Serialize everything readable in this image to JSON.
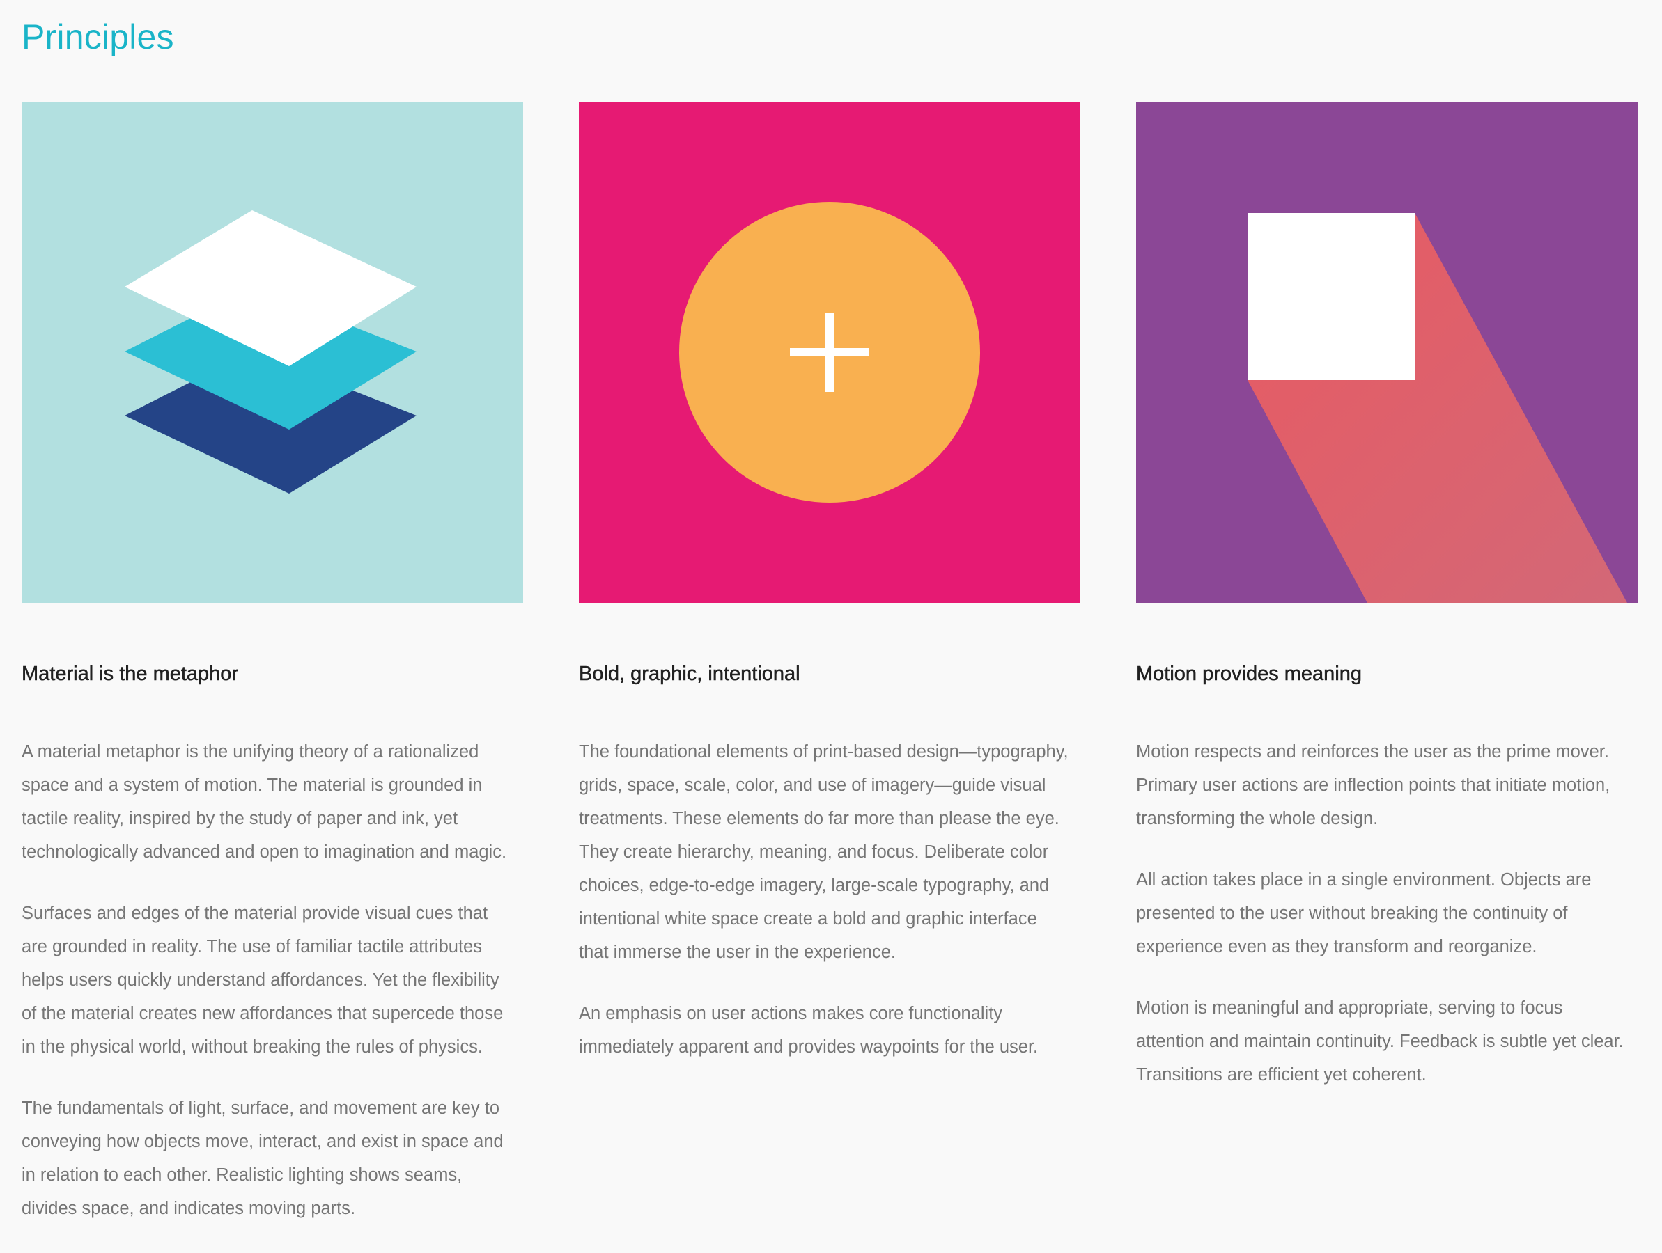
{
  "page_title": "Principles",
  "colors": {
    "title_accent": "#1ab4c8",
    "card1_bg": "#b2e0e0",
    "card2_bg": "#e61a73",
    "card3_bg": "#8b4796",
    "layer_white": "#ffffff",
    "layer_cyan": "#2bbfd4",
    "layer_navy": "#244487",
    "circle_orange": "#f9b050",
    "shadow_red": "#e85a62"
  },
  "principles": [
    {
      "illustration_icon": "layers-icon",
      "heading": "Material is the metaphor",
      "paragraphs": [
        [
          "A material metaphor is the unifying theory of a rationalized",
          "space and a system of motion. The material is grounded in",
          "tactile reality, inspired by the study of paper and ink, yet",
          "technologically advanced and open to imagination and magic."
        ],
        [
          "Surfaces and edges of the material provide visual cues that",
          "are grounded in reality. The use of familiar tactile attributes",
          "helps users quickly understand affordances. Yet the flexibility",
          "of the material creates new affordances that supercede those",
          "in the physical world, without breaking the rules of physics."
        ],
        [
          "The fundamentals of light, surface, and movement are key to",
          "conveying how objects move, interact, and exist in space and",
          "in relation to each other. Realistic lighting shows seams,",
          "divides space, and indicates moving parts."
        ]
      ]
    },
    {
      "illustration_icon": "add-circle-icon",
      "heading": "Bold, graphic, intentional",
      "paragraphs": [
        [
          "The foundational elements of print-based design—typography,",
          "grids, space, scale, color, and use of imagery—guide visual",
          "treatments. These elements do far more than please the eye.",
          "They create hierarchy, meaning, and focus. Deliberate color",
          "choices, edge-to-edge imagery, large-scale typography, and",
          "intentional white space create a bold and graphic interface",
          "that immerse the user in the experience."
        ],
        [
          "An emphasis on user actions makes core functionality",
          "immediately apparent and provides waypoints for the user."
        ]
      ]
    },
    {
      "illustration_icon": "square-shadow-icon",
      "heading": "Motion provides meaning",
      "paragraphs": [
        [
          "Motion respects and reinforces the user as the prime mover.",
          "Primary user actions are inflection points that initiate motion,",
          "transforming the whole design."
        ],
        [
          "All action takes place in a single environment. Objects are",
          "presented to the user without breaking the continuity of",
          "experience even as they transform and reorganize."
        ],
        [
          "Motion is meaningful and appropriate, serving to focus",
          "attention and maintain continuity. Feedback is subtle yet clear.",
          "Transitions are efficient yet coherent."
        ]
      ]
    }
  ]
}
